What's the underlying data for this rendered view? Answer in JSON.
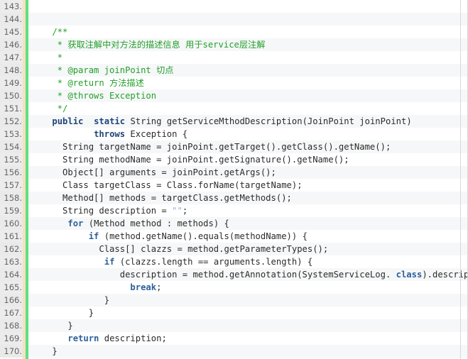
{
  "editor": {
    "first_line_number": 143,
    "last_line_number": 170,
    "colors": {
      "background": "#ffffff",
      "alt_row_background": "#f6f7f8",
      "gutter_background": "#ececec",
      "gutter_text": "#666666",
      "gutter_marker_beige": "#f7e0c0",
      "gutter_marker_green": "#5fe07f",
      "comment": "#22a02a",
      "keyword": "#20467a",
      "string": "#9aa7e0",
      "text": "#2b2b2b",
      "right_rule": "#d9d9d9"
    },
    "lines": [
      {
        "n": "143.",
        "tokens": []
      },
      {
        "n": "144.",
        "tokens": []
      },
      {
        "n": "145.",
        "tokens": [
          {
            "t": "    /**",
            "c": "tok-comment"
          }
        ]
      },
      {
        "n": "146.",
        "tokens": [
          {
            "t": "     * 获取注解中对方法的描述信息 用于service层注解",
            "c": "tok-comment"
          }
        ]
      },
      {
        "n": "147.",
        "tokens": [
          {
            "t": "     *",
            "c": "tok-comment"
          }
        ]
      },
      {
        "n": "148.",
        "tokens": [
          {
            "t": "     * @param joinPoint 切点",
            "c": "tok-comment"
          }
        ]
      },
      {
        "n": "149.",
        "tokens": [
          {
            "t": "     * @return 方法描述",
            "c": "tok-comment"
          }
        ]
      },
      {
        "n": "150.",
        "tokens": [
          {
            "t": "     * @throws Exception",
            "c": "tok-comment"
          }
        ]
      },
      {
        "n": "151.",
        "tokens": [
          {
            "t": "     */",
            "c": "tok-comment"
          }
        ]
      },
      {
        "n": "152.",
        "tokens": [
          {
            "t": "    ",
            "c": "tok-plain"
          },
          {
            "t": "public",
            "c": "tok-kw"
          },
          {
            "t": "  ",
            "c": "tok-plain"
          },
          {
            "t": "static",
            "c": "tok-kw"
          },
          {
            "t": " String getServiceMthodDescription(JoinPoint joinPoint)",
            "c": "tok-plain"
          }
        ]
      },
      {
        "n": "153.",
        "tokens": [
          {
            "t": "            ",
            "c": "tok-plain"
          },
          {
            "t": "throws",
            "c": "tok-kw"
          },
          {
            "t": " Exception {",
            "c": "tok-plain"
          }
        ]
      },
      {
        "n": "154.",
        "tokens": [
          {
            "t": "      String targetName = joinPoint.getTarget().getClass().getName();",
            "c": "tok-plain"
          }
        ]
      },
      {
        "n": "155.",
        "tokens": [
          {
            "t": "      String methodName = joinPoint.getSignature().getName();",
            "c": "tok-plain"
          }
        ]
      },
      {
        "n": "156.",
        "tokens": [
          {
            "t": "      Object[] arguments = joinPoint.getArgs();",
            "c": "tok-plain"
          }
        ]
      },
      {
        "n": "157.",
        "tokens": [
          {
            "t": "      Class targetClass = Class.forName(targetName);",
            "c": "tok-plain"
          }
        ]
      },
      {
        "n": "158.",
        "tokens": [
          {
            "t": "      Method[] methods = targetClass.getMethods();",
            "c": "tok-plain"
          }
        ]
      },
      {
        "n": "159.",
        "tokens": [
          {
            "t": "      String description = ",
            "c": "tok-plain"
          },
          {
            "t": "\"\"",
            "c": "tok-str"
          },
          {
            "t": ";",
            "c": "tok-plain"
          }
        ]
      },
      {
        "n": "160.",
        "tokens": [
          {
            "t": "       ",
            "c": "tok-plain"
          },
          {
            "t": "for",
            "c": "tok-kw2"
          },
          {
            "t": " (Method method : methods) {",
            "c": "tok-plain"
          }
        ]
      },
      {
        "n": "161.",
        "tokens": [
          {
            "t": "           ",
            "c": "tok-plain"
          },
          {
            "t": "if",
            "c": "tok-kw2"
          },
          {
            "t": " (method.getName().equals(methodName)) {",
            "c": "tok-plain"
          }
        ]
      },
      {
        "n": "162.",
        "tokens": [
          {
            "t": "             Class[] clazzs = method.getParameterTypes();",
            "c": "tok-plain"
          }
        ]
      },
      {
        "n": "163.",
        "tokens": [
          {
            "t": "              ",
            "c": "tok-plain"
          },
          {
            "t": "if",
            "c": "tok-kw2"
          },
          {
            "t": " (clazzs.length == arguments.length) {",
            "c": "tok-plain"
          }
        ]
      },
      {
        "n": "164.",
        "tokens": [
          {
            "t": "                 description = method.getAnnotation(SystemServiceLog. ",
            "c": "tok-plain"
          },
          {
            "t": "class",
            "c": "tok-kw2"
          },
          {
            "t": ").descript",
            "c": "tok-plain"
          }
        ]
      },
      {
        "n": "165.",
        "tokens": [
          {
            "t": "                   ",
            "c": "tok-plain"
          },
          {
            "t": "break",
            "c": "tok-kw2"
          },
          {
            "t": ";",
            "c": "tok-plain"
          }
        ]
      },
      {
        "n": "166.",
        "tokens": [
          {
            "t": "              }",
            "c": "tok-plain"
          }
        ]
      },
      {
        "n": "167.",
        "tokens": [
          {
            "t": "           }",
            "c": "tok-plain"
          }
        ]
      },
      {
        "n": "168.",
        "tokens": [
          {
            "t": "       }",
            "c": "tok-plain"
          }
        ]
      },
      {
        "n": "169.",
        "tokens": [
          {
            "t": "       ",
            "c": "tok-plain"
          },
          {
            "t": "return",
            "c": "tok-kw2"
          },
          {
            "t": " description;",
            "c": "tok-plain"
          }
        ]
      },
      {
        "n": "170.",
        "tokens": [
          {
            "t": "    }",
            "c": "tok-plain"
          }
        ]
      }
    ]
  }
}
